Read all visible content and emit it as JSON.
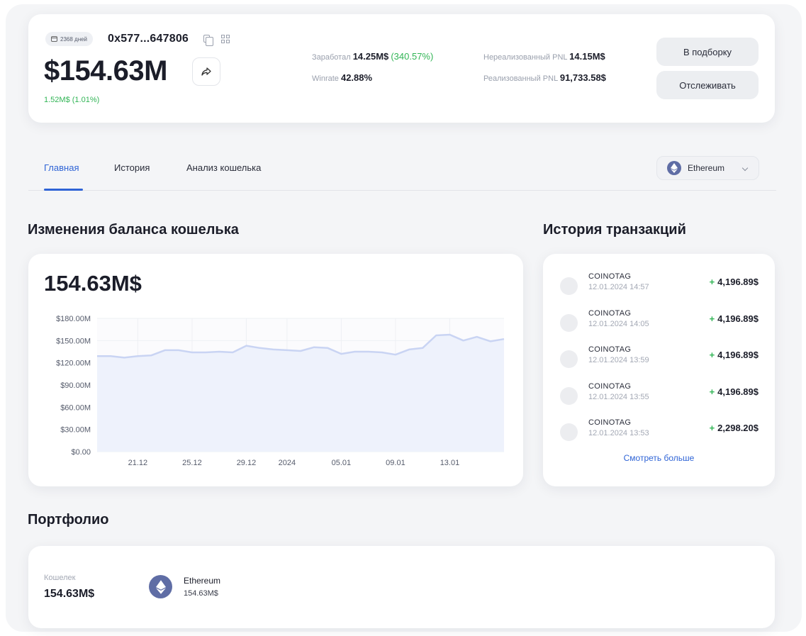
{
  "header": {
    "days_badge": "2368 дней",
    "address": "0x577...647806",
    "balance": "$154.63M",
    "change": "1.52M$ (1.01%)",
    "earned_label": "Заработал",
    "earned_value": "14.25M$",
    "earned_pct": "(340.57%)",
    "winrate_label": "Winrate",
    "winrate_value": "42.88%",
    "unrealized_label": "Нереализованный PNL",
    "unrealized_value": "14.15M$",
    "realized_label": "Реализованный PNL",
    "realized_value": "91,733.58$",
    "add_to_selection_button": "В подборку",
    "track_button": "Отслеживать"
  },
  "tabs": [
    {
      "label": "Главная",
      "active": true
    },
    {
      "label": "История",
      "active": false
    },
    {
      "label": "Анализ кошелька",
      "active": false
    }
  ],
  "network_select": {
    "selected": "Ethereum",
    "icon": "ethereum-icon"
  },
  "balance_section": {
    "title": "Изменения баланса кошелька",
    "current_value": "154.63M$"
  },
  "chart_data": {
    "type": "area",
    "title": "",
    "xlabel": "",
    "ylabel": "",
    "ylim": [
      0,
      180
    ],
    "y_unit": "M$",
    "y_ticks": [
      "$180.00M",
      "$150.00M",
      "$120.00M",
      "$90.00M",
      "$60.00M",
      "$30.00M",
      "$0.00"
    ],
    "x_ticks": [
      "21.12",
      "25.12",
      "29.12",
      "2024",
      "05.01",
      "09.01",
      "13.01"
    ],
    "x": [
      "18.12",
      "19.12",
      "20.12",
      "21.12",
      "22.12",
      "23.12",
      "24.12",
      "25.12",
      "26.12",
      "27.12",
      "28.12",
      "29.12",
      "30.12",
      "31.12",
      "01.01",
      "02.01",
      "03.01",
      "04.01",
      "05.01",
      "06.01",
      "07.01",
      "08.01",
      "09.01",
      "10.01",
      "11.01",
      "12.01",
      "13.01",
      "14.01",
      "15.01",
      "16.01"
    ],
    "series": [
      {
        "values": [
          129,
          129,
          127,
          129,
          130,
          137,
          137,
          134,
          134,
          135,
          134,
          143,
          140,
          138,
          137,
          136,
          141,
          140,
          132,
          135,
          135,
          134,
          131,
          138,
          140,
          157,
          158,
          150,
          155,
          149,
          152
        ]
      }
    ],
    "grid": true,
    "colors": {
      "line": "#c9d4f3",
      "fill": "#eef2fc"
    }
  },
  "transactions_section": {
    "title": "История транзакций",
    "items": [
      {
        "name": "COINOTAG",
        "time": "12.01.2024 14:57",
        "sign": "+",
        "amount": "4,196.89$"
      },
      {
        "name": "COINOTAG",
        "time": "12.01.2024 14:05",
        "sign": "+",
        "amount": "4,196.89$"
      },
      {
        "name": "COINOTAG",
        "time": "12.01.2024 13:59",
        "sign": "+",
        "amount": "4,196.89$"
      },
      {
        "name": "COINOTAG",
        "time": "12.01.2024 13:55",
        "sign": "+",
        "amount": "4,196.89$"
      },
      {
        "name": "COINOTAG",
        "time": "12.01.2024 13:53",
        "sign": "+",
        "amount": "2,298.20$"
      }
    ],
    "see_more": "Смотреть больше"
  },
  "portfolio": {
    "title": "Портфолио",
    "wallet_label": "Кошелек",
    "wallet_value": "154.63M$",
    "asset": {
      "name": "Ethereum",
      "value": "154.63M$",
      "icon": "ethereum-icon"
    }
  },
  "colors": {
    "accent": "#2f64d6",
    "positive": "#32b556",
    "text": "#1b1d29",
    "muted": "#9aa0ad"
  }
}
